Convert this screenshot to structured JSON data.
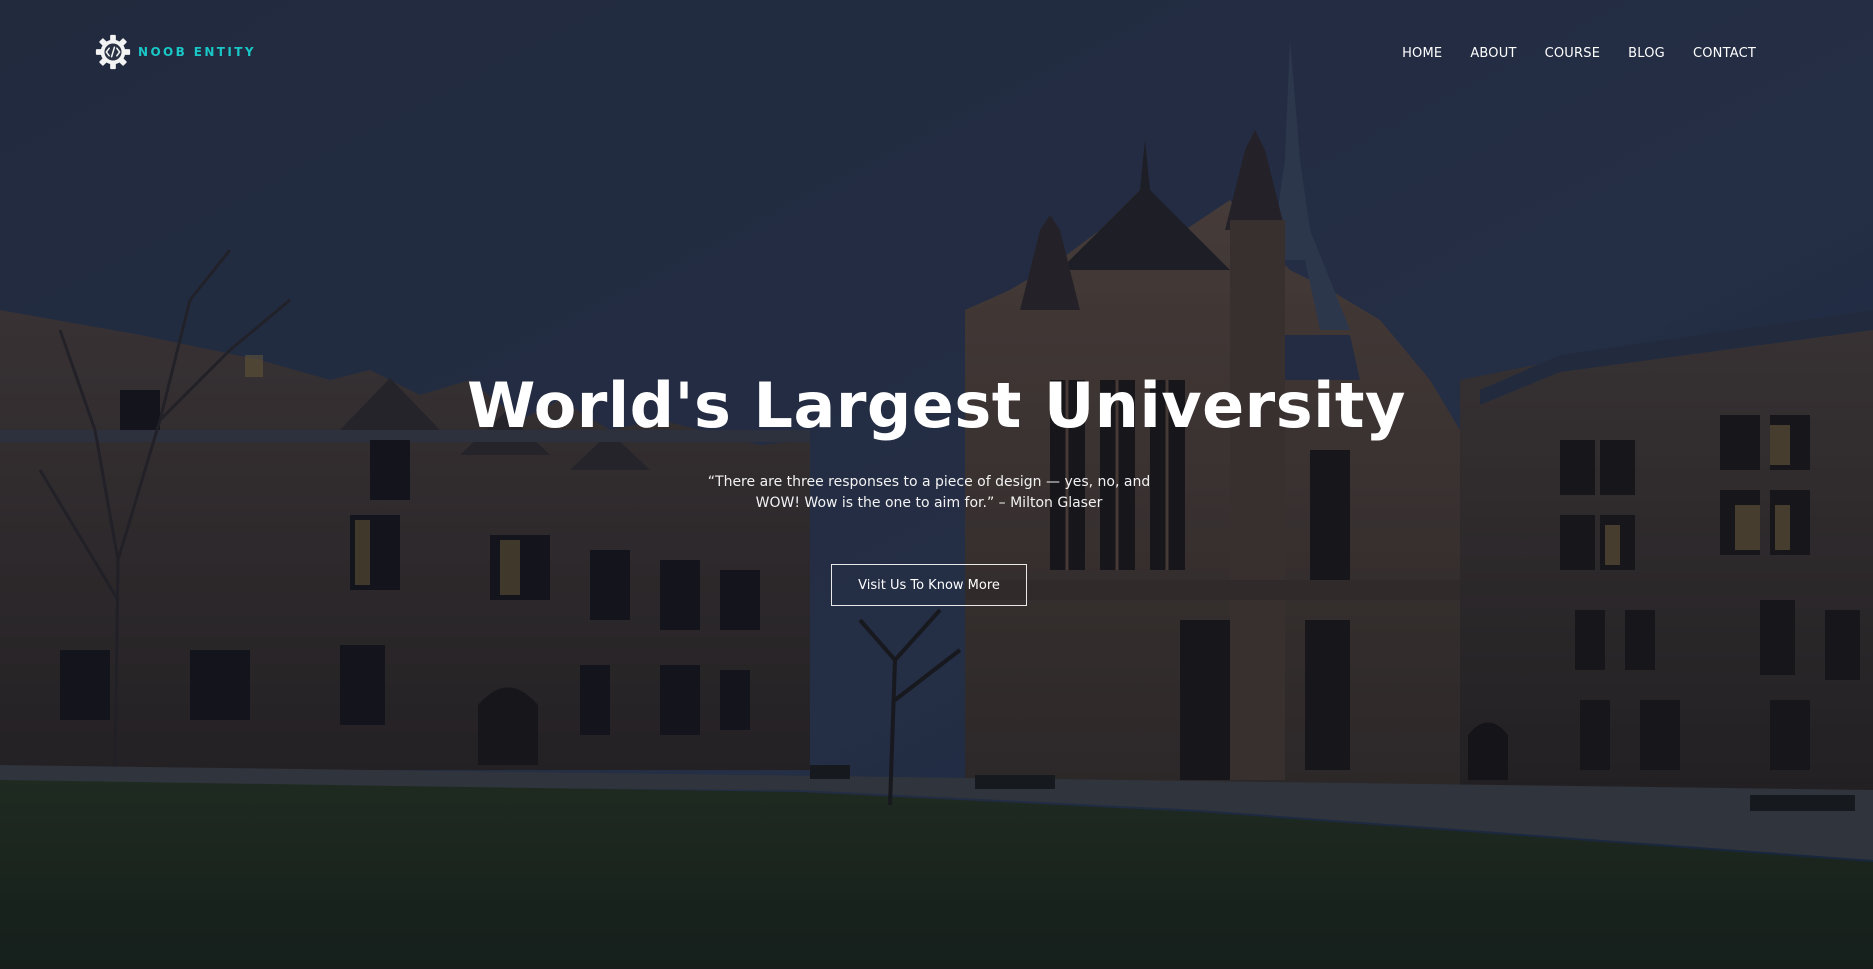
{
  "brand": {
    "logo_text": "NOOB ENTITY",
    "logo_icon": "gear-code-icon",
    "accent_color": "#19c7c7"
  },
  "nav": {
    "items": [
      {
        "label": "HOME"
      },
      {
        "label": "ABOUT"
      },
      {
        "label": "COURSE"
      },
      {
        "label": "BLOG"
      },
      {
        "label": "CONTACT"
      }
    ]
  },
  "hero": {
    "title": "World's Largest University",
    "quote": "“There are three responses to a piece of design — yes, no, and WOW! Wow is the one to aim for.” – Milton Glaser",
    "cta_label": "Visit Us To Know More",
    "background": "university-campus-photo"
  }
}
